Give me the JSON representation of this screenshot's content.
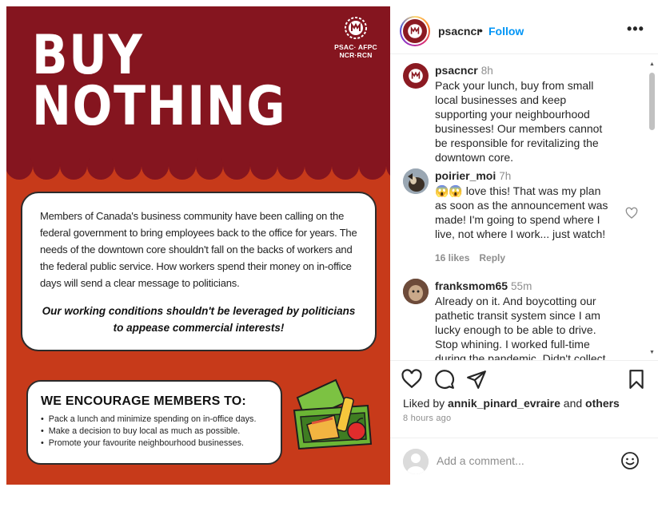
{
  "poster": {
    "headline_line1": "BUY",
    "headline_line2": "NOTHING",
    "logo_line1": "PSAC· AFPC",
    "logo_line2": "NCR·RCN",
    "message": "Members of Canada's business community have been  calling on the federal government to bring employees back to the office for years. The needs of the downtown core  shouldn't fall on the backs of workers and the federal public service.  How workers spend their money on in-office days will send a clear message to politicians.",
    "emphasis": "Our working conditions shouldn't be leveraged by politicians to appease commercial interests!",
    "encourage_title": "WE ENCOURAGE MEMBERS TO:",
    "encourage_items": [
      "Pack a lunch and minimize spending on in-office days.",
      "Make a decision to buy local as much as possible.",
      "Promote your favourite neighbourhood businesses."
    ],
    "colors": {
      "maroon": "#85151f",
      "red_orange": "#c73a1a"
    }
  },
  "header": {
    "username": "psacncr",
    "dot": "•",
    "follow_label": "Follow",
    "more_label": "•••"
  },
  "comments": [
    {
      "username": "psacncr",
      "time": "8h",
      "text": "Pack your lunch, buy from small local businesses and keep supporting your neighbourhood businesses! Our members cannot be responsible for revitalizing the downtown core."
    },
    {
      "username": "poirier_moi",
      "time": "7h",
      "emoji": "😱😱",
      "text": "love this! That was my plan as soon as the announcement was made! I'm going to spend where I live, not where I work... just watch!",
      "likes": "16 likes",
      "reply_label": "Reply"
    },
    {
      "username": "franksmom65",
      "time": "55m",
      "text": "Already on it. And boycotting our pathetic transit system since I am lucky enough to be able to drive. Stop whining. I worked full-time during the pandemic. Didn't collect"
    }
  ],
  "scrollbar": {
    "up_arrow": "▲",
    "down_arrow": "▼"
  },
  "actions": {
    "icons": [
      "heart-icon",
      "comment-icon",
      "share-icon",
      "bookmark-icon"
    ]
  },
  "likes": {
    "prefix": "Liked by",
    "user": "annik_pinard_evraire",
    "and_label": "and",
    "others": "others"
  },
  "post_age": "8 hours ago",
  "add_comment": {
    "placeholder": "Add a comment..."
  },
  "brand_colors": {
    "link_blue": "#0095f6",
    "muted_gray": "#8e8e8e",
    "text": "#262626"
  }
}
